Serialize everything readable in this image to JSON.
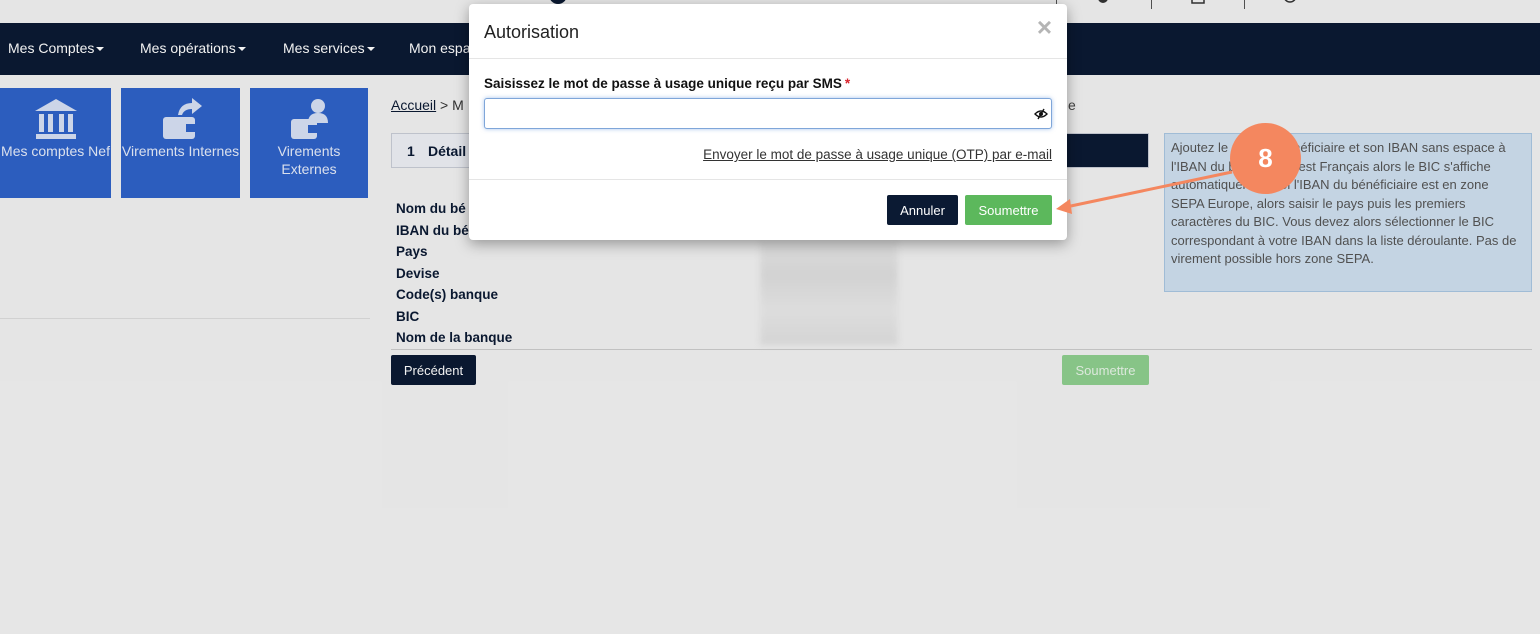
{
  "nav": {
    "items": [
      {
        "label": "Mes Comptes"
      },
      {
        "label": "Mes opérations"
      },
      {
        "label": "Mes services"
      },
      {
        "label": "Mon espa"
      }
    ]
  },
  "tiles": [
    {
      "label": "Mes comptes Nef",
      "icon": "bank-icon"
    },
    {
      "label": "Virements Internes",
      "icon": "wallet-transfer-icon"
    },
    {
      "label": "Virements Externes",
      "icon": "user-transfer-icon"
    }
  ],
  "breadcrumb": {
    "home": "Accueil",
    "separator": ">",
    "next": "M",
    "suffix": "e"
  },
  "steps": {
    "number": "1",
    "label": "Détail"
  },
  "info_text": "Ajoutez le nom du bénéficiaire et son IBAN sans espace à l'IBAN du bénéficiaire est Français alors le BIC s'affiche automatiquement. Si l'IBAN du bénéficiaire est en zone SEPA Europe, alors saisir le pays puis les premiers caractères du BIC. Vous devez alors sélectionner le BIC correspondant à votre IBAN dans la liste déroulante. Pas de virement possible hors zone SEPA.",
  "details": {
    "labels": [
      "Nom du bé",
      "IBAN du bé",
      "Pays",
      "Devise",
      "Code(s) banque",
      "BIC",
      "Nom de la banque"
    ]
  },
  "buttons": {
    "previous": "Précédent",
    "submit_bg": "Soumettre"
  },
  "modal": {
    "title": "Autorisation",
    "close": "×",
    "field_label": "Saisissez le mot de passe à usage unique reçu par SMS",
    "required_mark": "*",
    "input_value": "",
    "email_link": "Envoyer le mot de passe à usage unique (OTP) par e-mail",
    "cancel": "Annuler",
    "submit": "Soumettre"
  },
  "annotation": {
    "step": "8",
    "color": "#f4875f"
  },
  "colors": {
    "nav": "#0b1a33",
    "tile": "#2f63c9",
    "success": "#5cb85c",
    "info_bg": "#cfe0f0"
  }
}
